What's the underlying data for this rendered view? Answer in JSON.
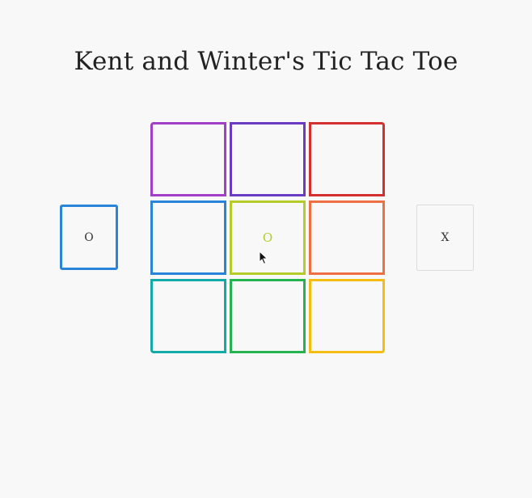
{
  "title": "Kent and Winter's Tic Tac Toe",
  "players": {
    "o": {
      "label": "O",
      "active": true,
      "color": "#2a84d8"
    },
    "x": {
      "label": "X",
      "active": false
    }
  },
  "board": {
    "cells": [
      {
        "value": "",
        "color": "#a33fc6"
      },
      {
        "value": "",
        "color": "#6a3cc4"
      },
      {
        "value": "",
        "color": "#d3302f"
      },
      {
        "value": "",
        "color": "#2a84d8"
      },
      {
        "value": "O",
        "color": "#b3cc2a"
      },
      {
        "value": "",
        "color": "#ef6f45"
      },
      {
        "value": "",
        "color": "#12aba7"
      },
      {
        "value": "",
        "color": "#25b350"
      },
      {
        "value": "",
        "color": "#f5bd14"
      }
    ]
  }
}
